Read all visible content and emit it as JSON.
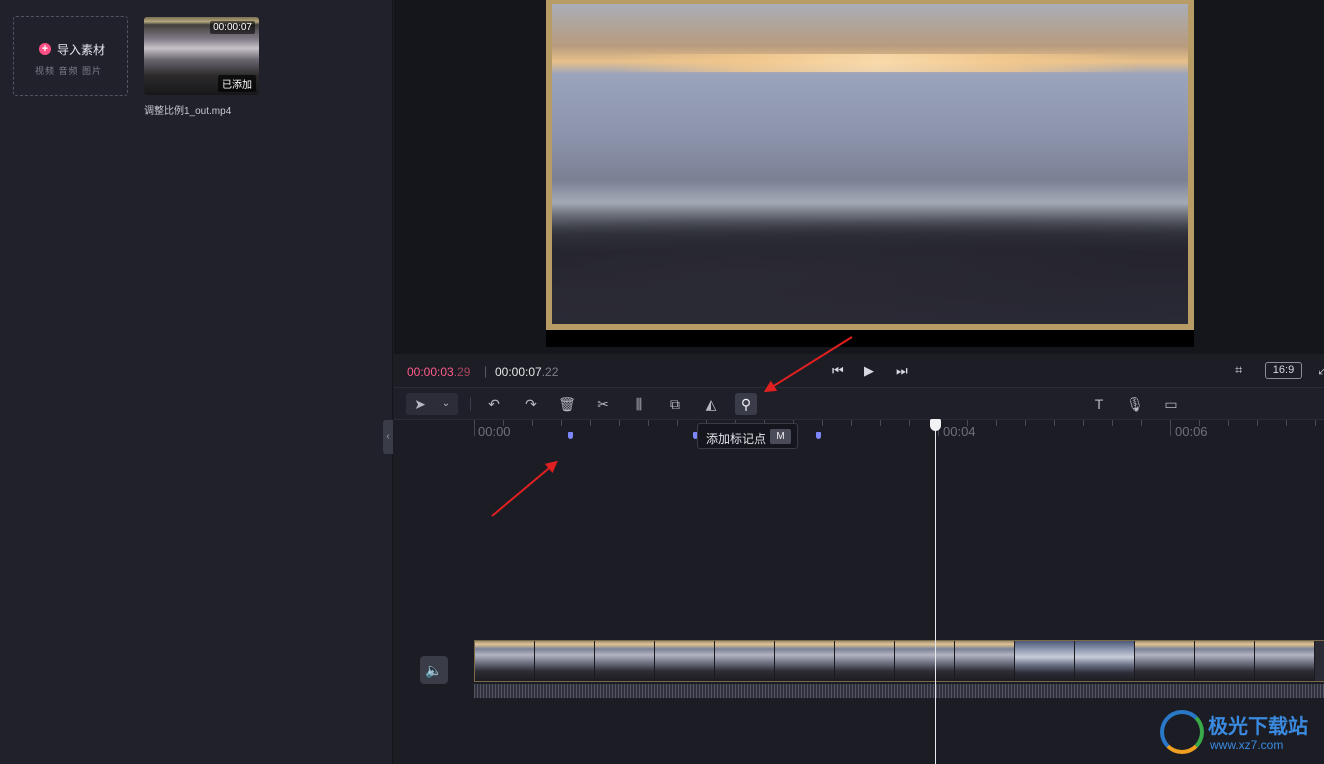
{
  "media_panel": {
    "import_label": "导入素材",
    "import_types": "视频  音频  图片",
    "clip": {
      "duration": "00:00:07",
      "status": "已添加",
      "filename": "调整比例1_out.mp4"
    }
  },
  "transport": {
    "current_main": "00:00:03",
    "current_frac": ".29",
    "separator": "|",
    "total_main": "00:00:07",
    "total_frac": ".22",
    "aspect_ratio": "16:9"
  },
  "timeline": {
    "ruler_labels": [
      "00:00",
      "00:04",
      "00:06"
    ],
    "tooltip_label": "添加标记点",
    "tooltip_key": "M"
  },
  "watermark": {
    "name": "极光下载站",
    "url": "www.xz7.com"
  },
  "colors": {
    "current_time": "#ff5b8a",
    "marker": "#7c86ff",
    "annotation_arrow": "#e02020"
  }
}
